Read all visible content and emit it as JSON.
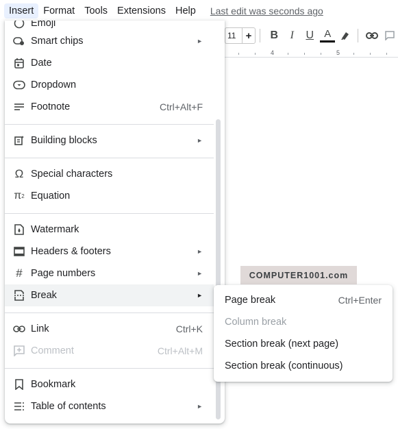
{
  "menubar": {
    "items": [
      "Insert",
      "Format",
      "Tools",
      "Extensions",
      "Help"
    ],
    "last_edit": "Last edit was seconds ago"
  },
  "toolbar": {
    "font_size": "11",
    "plus": "+",
    "bold": "B",
    "italic": "I",
    "underline": "U",
    "text_color": "A"
  },
  "ruler": {
    "marks": [
      "4",
      "5"
    ]
  },
  "watermark_text": "COMPUTER1001.com",
  "insert_menu": {
    "partial_item": "Emoji",
    "items": [
      {
        "label": "Smart chips",
        "shortcut": "",
        "submenu": true
      },
      {
        "label": "Date",
        "shortcut": "",
        "submenu": false
      },
      {
        "label": "Dropdown",
        "shortcut": "",
        "submenu": false
      },
      {
        "label": "Footnote",
        "shortcut": "Ctrl+Alt+F",
        "submenu": false
      },
      {
        "label": "Building blocks",
        "shortcut": "",
        "submenu": true
      },
      {
        "label": "Special characters",
        "shortcut": "",
        "submenu": false
      },
      {
        "label": "Equation",
        "shortcut": "",
        "submenu": false
      },
      {
        "label": "Watermark",
        "shortcut": "",
        "submenu": false
      },
      {
        "label": "Headers & footers",
        "shortcut": "",
        "submenu": true
      },
      {
        "label": "Page numbers",
        "shortcut": "",
        "submenu": true
      },
      {
        "label": "Break",
        "shortcut": "",
        "submenu": true
      },
      {
        "label": "Link",
        "shortcut": "Ctrl+K",
        "submenu": false
      },
      {
        "label": "Comment",
        "shortcut": "Ctrl+Alt+M",
        "submenu": false
      },
      {
        "label": "Bookmark",
        "shortcut": "",
        "submenu": false
      },
      {
        "label": "Table of contents",
        "shortcut": "",
        "submenu": true
      }
    ],
    "arrow": "►"
  },
  "break_submenu": {
    "items": [
      {
        "label": "Page break",
        "shortcut": "Ctrl+Enter"
      },
      {
        "label": "Column break",
        "shortcut": ""
      },
      {
        "label": "Section break (next page)",
        "shortcut": ""
      },
      {
        "label": "Section break (continuous)",
        "shortcut": ""
      }
    ]
  }
}
